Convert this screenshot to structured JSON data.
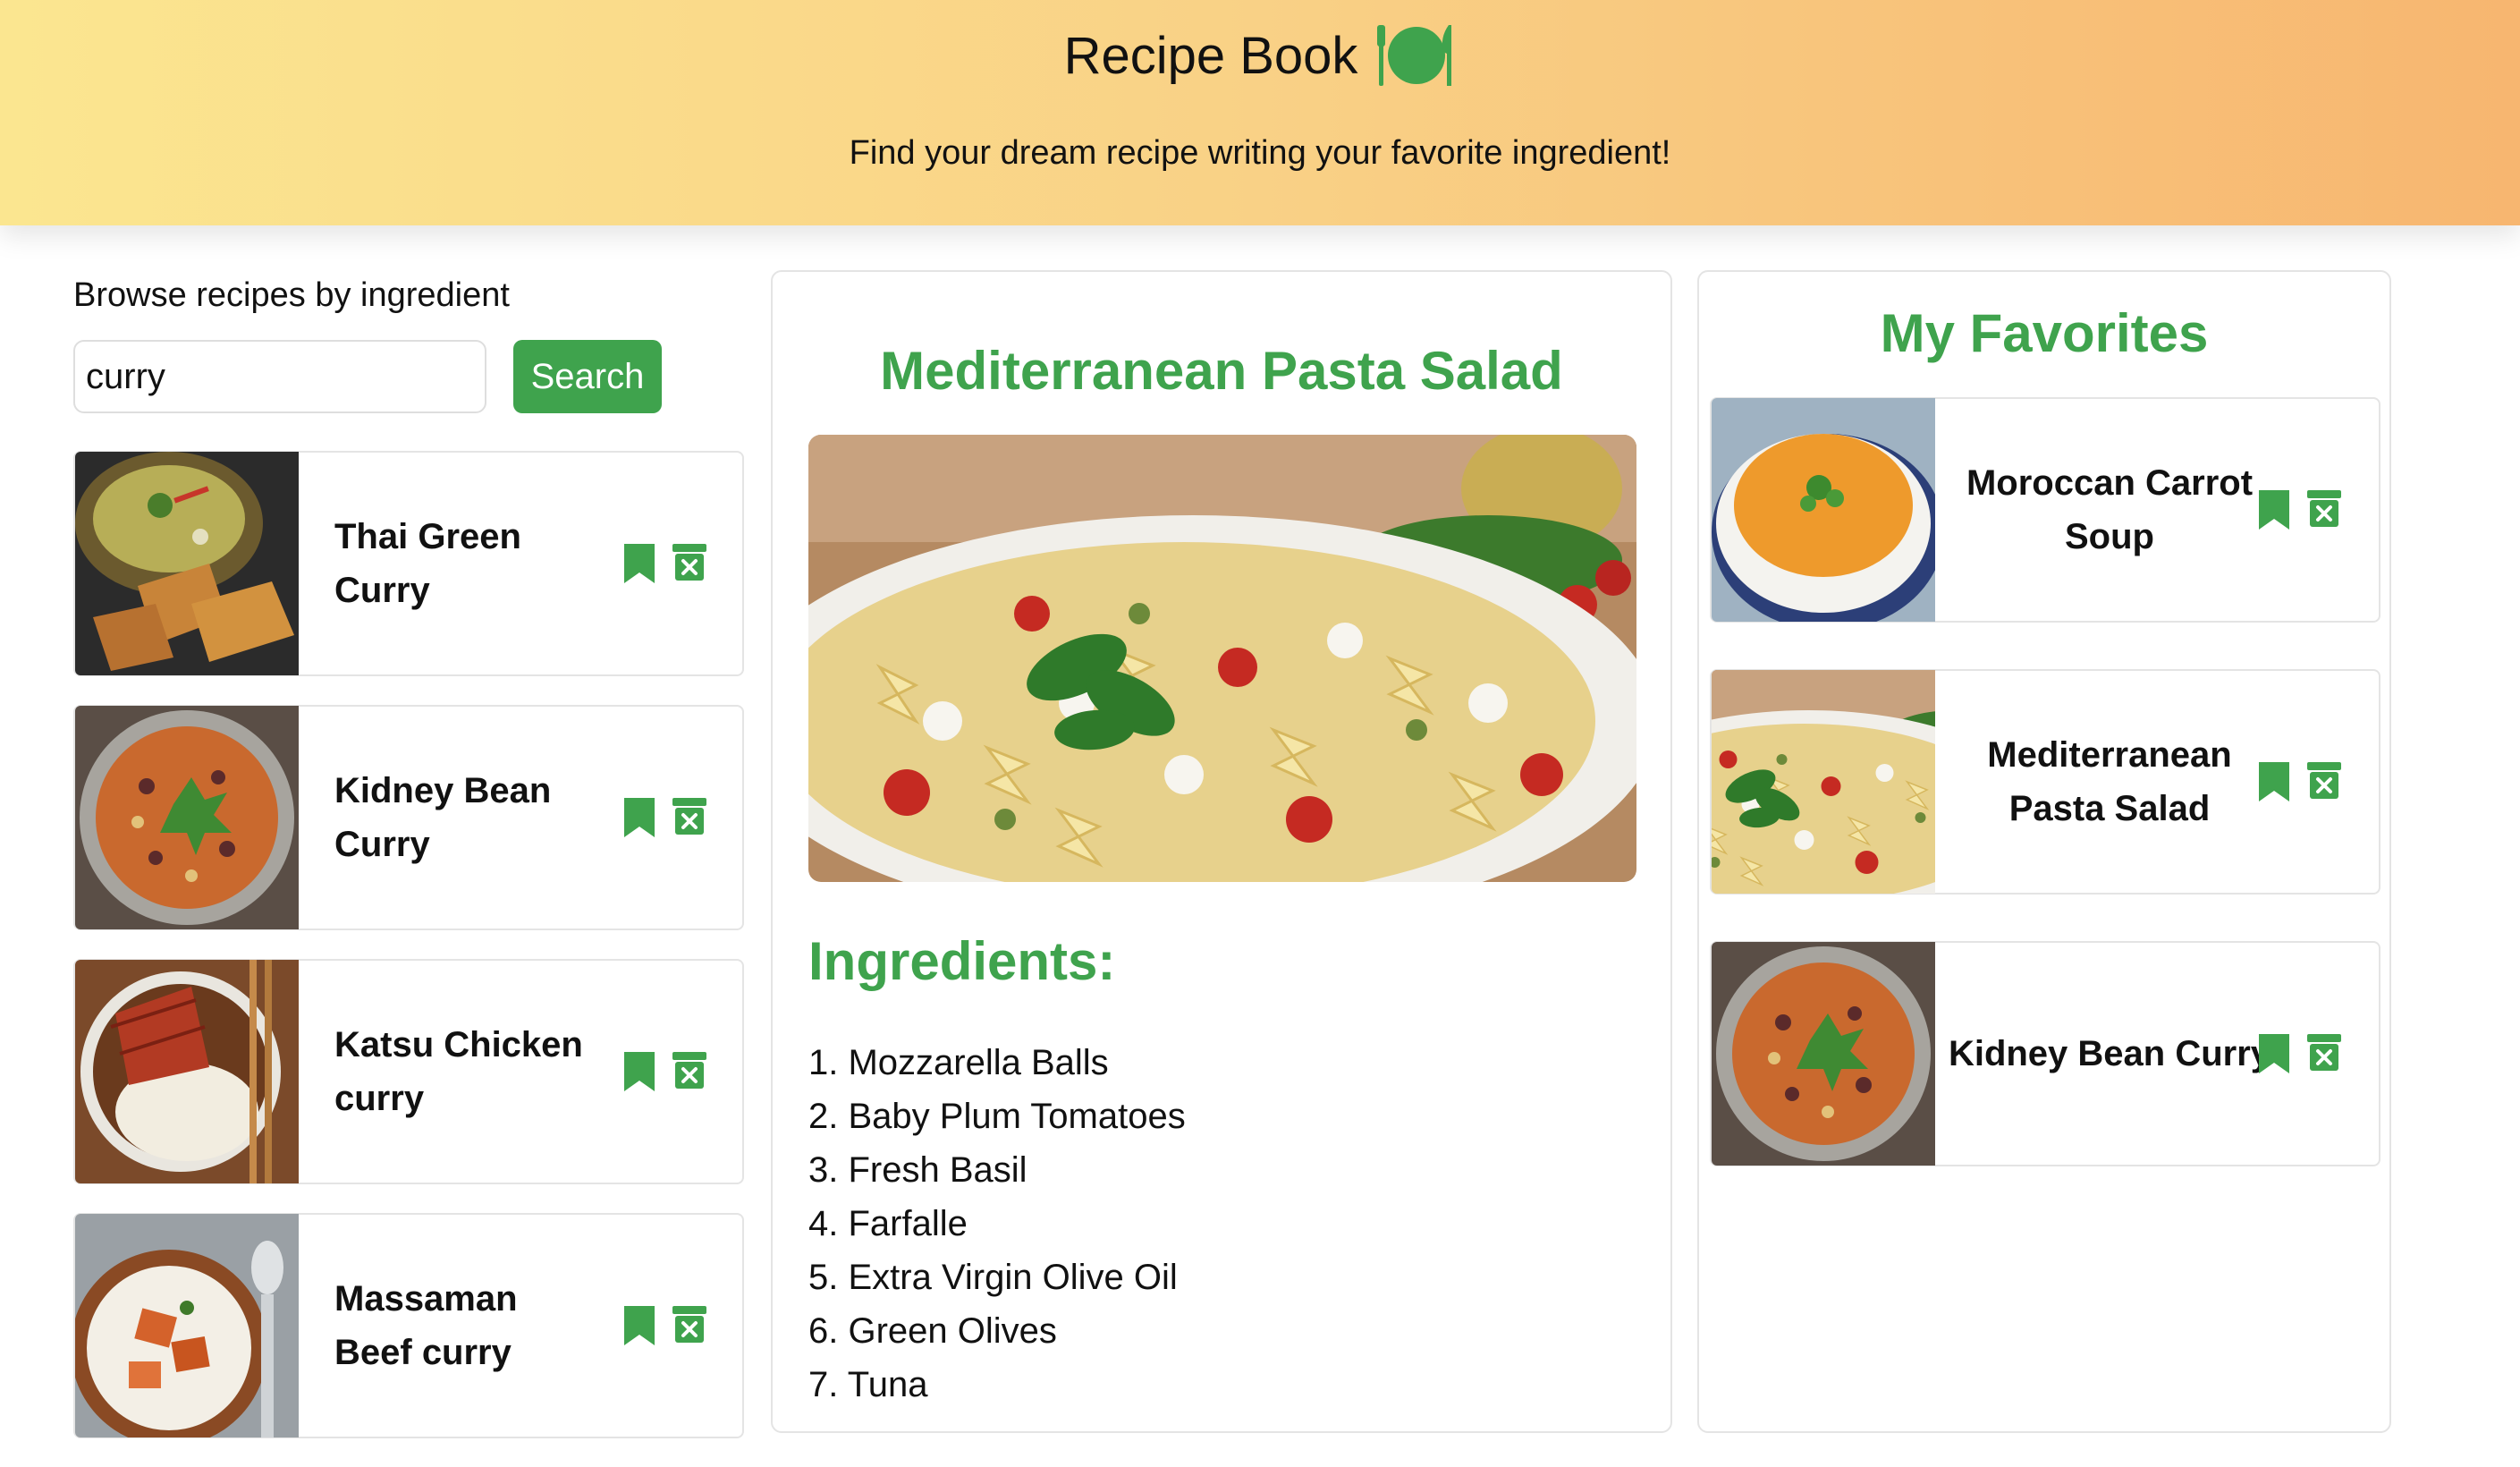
{
  "header": {
    "title": "Recipe Book",
    "logo_icon": "plate-cutlery-icon",
    "subtitle": "Find your dream recipe writing your favorite ingredient!"
  },
  "colors": {
    "accent": "#3fa34d",
    "header_gradient_start": "#fbe690",
    "header_gradient_end": "#f7b670"
  },
  "search": {
    "label": "Browse recipes by ingredient",
    "value": "curry",
    "button_label": "Search"
  },
  "results": [
    {
      "name": "Thai Green Curry",
      "image": "thai-green-curry-photo"
    },
    {
      "name": "Kidney Bean Curry",
      "image": "kidney-bean-curry-photo"
    },
    {
      "name": "Katsu Chicken curry",
      "image": "katsu-chicken-curry-photo"
    },
    {
      "name": "Massaman Beef curry",
      "image": "massaman-beef-curry-photo"
    }
  ],
  "card_actions": {
    "favorite_icon": "bookmark-icon",
    "delete_icon": "delete-box-icon"
  },
  "detail": {
    "title": "Mediterranean Pasta Salad",
    "image": "pasta-salad-photo",
    "ingredients_heading": "Ingredients:",
    "ingredients": [
      "1. Mozzarella Balls",
      "2. Baby Plum Tomatoes",
      "3. Fresh Basil",
      "4. Farfalle",
      "5. Extra Virgin Olive Oil",
      "6. Green Olives",
      "7. Tuna"
    ]
  },
  "favorites": {
    "title": "My Favorites",
    "items": [
      {
        "name": "Moroccan Carrot Soup",
        "image": "carrot-soup-photo"
      },
      {
        "name": "Mediterranean Pasta Salad",
        "image": "pasta-salad-photo"
      },
      {
        "name": "Kidney Bean Curry",
        "image": "kidney-bean-curry-photo"
      }
    ]
  }
}
